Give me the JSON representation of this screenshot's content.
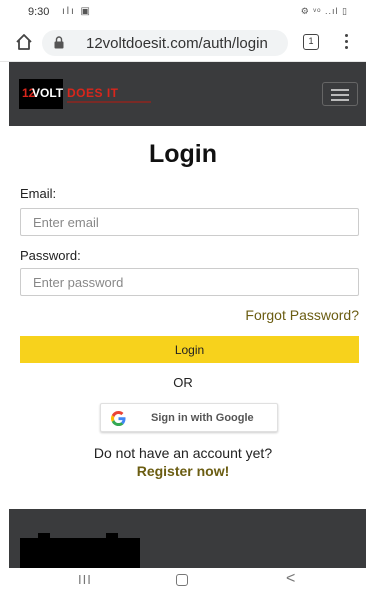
{
  "status_bar": {
    "time": "9:30",
    "left_icons": "ılı ▣",
    "right_icons": "⚙ ᵛᵒ ..ıl ▯"
  },
  "browser": {
    "url": "12voltdoesit.com/auth/login",
    "tab_count": "1"
  },
  "header": {
    "logo_12": "12",
    "logo_volt": "VOLT",
    "logo_rest": "DOES IT"
  },
  "login": {
    "title": "Login",
    "email_label": "Email:",
    "email_placeholder": "Enter email",
    "email_value": "",
    "password_label": "Password:",
    "password_placeholder": "Enter password",
    "password_value": "",
    "forgot_label": "Forgot Password?",
    "submit_label": "Login",
    "or_label": "OR",
    "google_label": "Sign in with Google",
    "no_account_text": "Do not have an account yet?",
    "register_label": "Register now!"
  },
  "nav": {
    "recent_label": "III",
    "back_label": "<"
  },
  "colors": {
    "accent_yellow": "#f7d21c",
    "link_olive": "#6b5d12",
    "header_dark": "#3a3b3d",
    "brand_red": "#d9261c"
  }
}
